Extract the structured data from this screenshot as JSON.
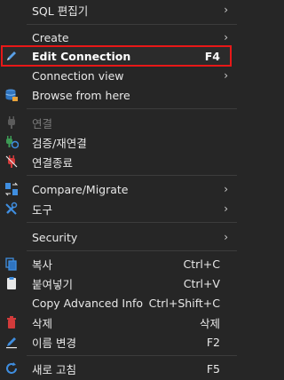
{
  "menu": {
    "items": [
      {
        "label": "SQL 편집기",
        "shortcut": "",
        "submenu": true
      },
      {
        "label": "Create",
        "shortcut": "",
        "submenu": true
      },
      {
        "label": "Edit Connection",
        "shortcut": "F4",
        "submenu": false
      },
      {
        "label": "Connection view",
        "shortcut": "",
        "submenu": true
      },
      {
        "label": "Browse from here",
        "shortcut": "",
        "submenu": false
      },
      {
        "label": "연결",
        "shortcut": "",
        "submenu": false,
        "disabled": true
      },
      {
        "label": "검증/재연결",
        "shortcut": "",
        "submenu": false
      },
      {
        "label": "연결종료",
        "shortcut": "",
        "submenu": false
      },
      {
        "label": "Compare/Migrate",
        "shortcut": "",
        "submenu": true
      },
      {
        "label": "도구",
        "shortcut": "",
        "submenu": true
      },
      {
        "label": "Security",
        "shortcut": "",
        "submenu": true
      },
      {
        "label": "복사",
        "shortcut": "Ctrl+C",
        "submenu": false
      },
      {
        "label": "붙여넣기",
        "shortcut": "Ctrl+V",
        "submenu": false
      },
      {
        "label": "Copy Advanced Info",
        "shortcut": "Ctrl+Shift+C",
        "submenu": false
      },
      {
        "label": "삭제",
        "shortcut": "삭제",
        "submenu": false
      },
      {
        "label": "이름 변경",
        "shortcut": "F2",
        "submenu": false
      },
      {
        "label": "새로 고침",
        "shortcut": "F5",
        "submenu": false
      }
    ],
    "submenu_arrow": "›",
    "highlight_color": "#e81818"
  }
}
